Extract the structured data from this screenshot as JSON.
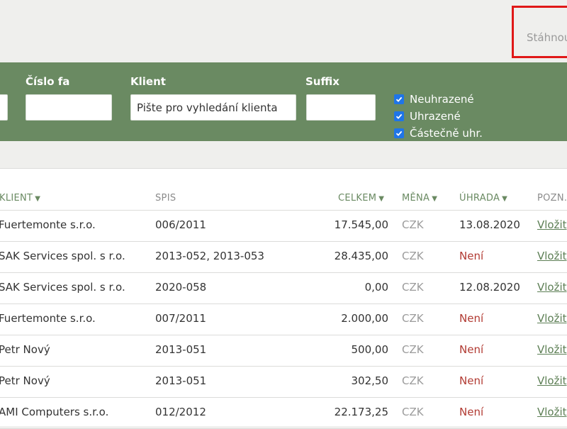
{
  "toolbar": {
    "download_label": "Stáhnout"
  },
  "filters": {
    "invoice_number_label": "Číslo fa",
    "client_label": "Klient",
    "client_placeholder": "Pište pro vyhledání klienta",
    "suffix_label": "Suffix",
    "checkboxes": [
      {
        "label": "Neuhrazené",
        "checked": true
      },
      {
        "label": "Uhrazené",
        "checked": true
      },
      {
        "label": "Částečně uhr.",
        "checked": true
      }
    ]
  },
  "table": {
    "headers": {
      "client": "KLIENT",
      "spis": "SPIS",
      "total": "CELKEM",
      "currency": "MĚNA",
      "paid": "ÚHRADA",
      "note": "POZN."
    },
    "rows": [
      {
        "client": "Fuertemonte s.r.o.",
        "spis": "006/2011",
        "total": "17.545,00",
        "currency": "CZK",
        "paid": "13.08.2020",
        "note": "Vložit"
      },
      {
        "client": "SAK Services spol. s r.o.",
        "spis": "2013-052, 2013-053",
        "total": "28.435,00",
        "currency": "CZK",
        "paid": "Není",
        "note": "Vložit"
      },
      {
        "client": "SAK Services spol. s r.o.",
        "spis": "2020-058",
        "total": "0,00",
        "currency": "CZK",
        "paid": "12.08.2020",
        "note": "Vložit"
      },
      {
        "client": "Fuertemonte s.r.o.",
        "spis": "007/2011",
        "total": "2.000,00",
        "currency": "CZK",
        "paid": "Není",
        "note": "Vložit"
      },
      {
        "client": "Petr Nový",
        "spis": "2013-051",
        "total": "500,00",
        "currency": "CZK",
        "paid": "Není",
        "note": "Vložit"
      },
      {
        "client": "Petr Nový",
        "spis": "2013-051",
        "total": "302,50",
        "currency": "CZK",
        "paid": "Není",
        "note": "Vložit"
      },
      {
        "client": "AMI Computers s.r.o.",
        "spis": "012/2012",
        "total": "22.173,25",
        "currency": "CZK",
        "paid": "Není",
        "note": "Vložit"
      }
    ]
  }
}
